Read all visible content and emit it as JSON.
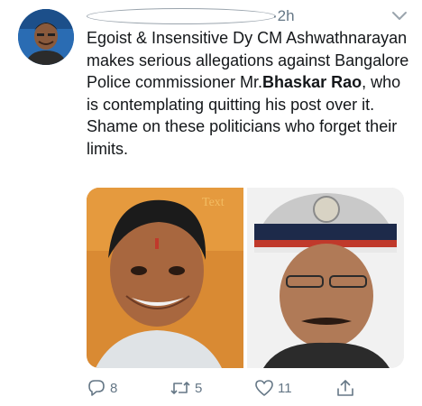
{
  "tweet": {
    "time": "·2h",
    "text": {
      "part1": "Egoist & Insensitive Dy CM Ashwathnarayan makes serious allegations against Bangalore Police commissioner Mr.",
      "bold": "Bhaskar Rao",
      "part2": ", who is contemplating quitting his post over it. Shame on these politicians who forget their limits."
    },
    "media_watermark": "Text",
    "actions": {
      "replies": "8",
      "retweets": "5",
      "likes": "11"
    }
  },
  "icons": {
    "reply": "reply-icon",
    "retweet": "retweet-icon",
    "like": "heart-icon",
    "share": "share-icon",
    "menu": "chevron-down-icon"
  },
  "colors": {
    "text": "#14171a",
    "muted": "#657786"
  }
}
